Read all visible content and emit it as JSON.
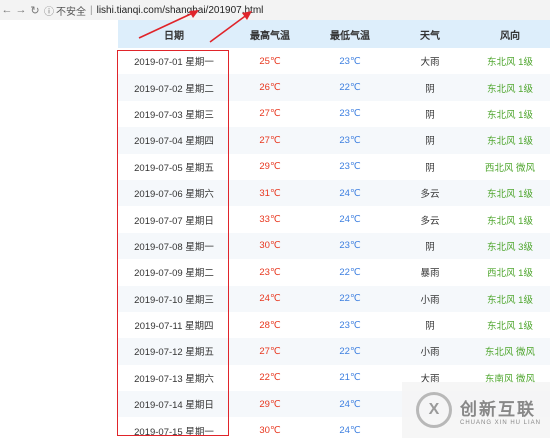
{
  "browser": {
    "back_icon": "back-arrow-icon",
    "forward_icon": "forward-arrow-icon",
    "reload_icon": "reload-icon",
    "security_label": "不安全",
    "url": "lishi.tianqi.com/shanghai/201907.html"
  },
  "table": {
    "headers": [
      "日期",
      "最高气温",
      "最低气温",
      "天气",
      "风向"
    ],
    "rows": [
      {
        "date": "2019-07-01 星期一",
        "high": "25℃",
        "low": "23℃",
        "weather": "大雨",
        "wind": "东北风 1级"
      },
      {
        "date": "2019-07-02 星期二",
        "high": "26℃",
        "low": "22℃",
        "weather": "阴",
        "wind": "东北风 1级"
      },
      {
        "date": "2019-07-03 星期三",
        "high": "27℃",
        "low": "23℃",
        "weather": "阴",
        "wind": "东北风 1级"
      },
      {
        "date": "2019-07-04 星期四",
        "high": "27℃",
        "low": "23℃",
        "weather": "阴",
        "wind": "东北风 1级"
      },
      {
        "date": "2019-07-05 星期五",
        "high": "29℃",
        "low": "23℃",
        "weather": "阴",
        "wind": "西北风 微风"
      },
      {
        "date": "2019-07-06 星期六",
        "high": "31℃",
        "low": "24℃",
        "weather": "多云",
        "wind": "东北风 1级"
      },
      {
        "date": "2019-07-07 星期日",
        "high": "33℃",
        "low": "24℃",
        "weather": "多云",
        "wind": "东北风 1级"
      },
      {
        "date": "2019-07-08 星期一",
        "high": "30℃",
        "low": "23℃",
        "weather": "阴",
        "wind": "东北风 3级"
      },
      {
        "date": "2019-07-09 星期二",
        "high": "23℃",
        "low": "22℃",
        "weather": "暴雨",
        "wind": "西北风 1级"
      },
      {
        "date": "2019-07-10 星期三",
        "high": "24℃",
        "low": "22℃",
        "weather": "小雨",
        "wind": "东北风 1级"
      },
      {
        "date": "2019-07-11 星期四",
        "high": "28℃",
        "low": "23℃",
        "weather": "阴",
        "wind": "东北风 1级"
      },
      {
        "date": "2019-07-12 星期五",
        "high": "27℃",
        "low": "22℃",
        "weather": "小雨",
        "wind": "东北风 微风"
      },
      {
        "date": "2019-07-13 星期六",
        "high": "22℃",
        "low": "21℃",
        "weather": "大雨",
        "wind": "东南风 微风"
      },
      {
        "date": "2019-07-14 星期日",
        "high": "29℃",
        "low": "24℃",
        "weather": "",
        "wind": ""
      },
      {
        "date": "2019-07-15 星期一",
        "high": "30℃",
        "low": "24℃",
        "weather": "",
        "wind": ""
      }
    ]
  },
  "annotation": {
    "color": "#e0242a"
  },
  "watermark": {
    "logo_letter": "X",
    "name_cn": "创新互联",
    "name_en": "CHUANG XIN HU LIAN"
  }
}
